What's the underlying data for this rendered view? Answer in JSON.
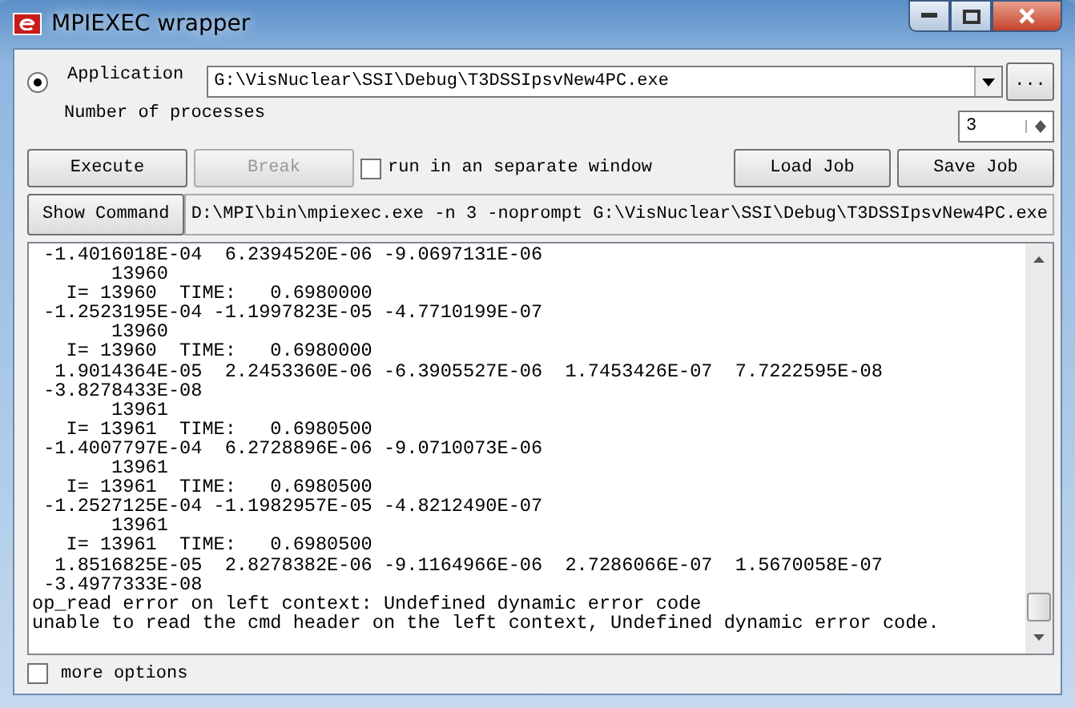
{
  "window": {
    "title": "MPIEXEC wrapper"
  },
  "application": {
    "selected": true,
    "label": "Application",
    "value": "G:\\VisNuclear\\SSI\\Debug\\T3DSSIpsvNew4PC.exe",
    "browse": "..."
  },
  "processes": {
    "label": "Number of processes",
    "value": "3"
  },
  "buttons": [
    {
      "label": "Execute",
      "disabled": false
    },
    {
      "label": "Break",
      "disabled": true
    }
  ],
  "separate_window": {
    "label": "run in an separate window",
    "checked": false
  },
  "job_buttons": [
    {
      "label": "Load Job"
    },
    {
      "label": "Save Job"
    }
  ],
  "show_command": {
    "label": "Show Command",
    "value": "D:\\MPI\\bin\\mpiexec.exe -n 3  -noprompt G:\\VisNuclear\\SSI\\Debug\\T3DSSIpsvNew4PC.exe"
  },
  "output": [
    " -1.4016018E-04  6.2394520E-06 -9.0697131E-06",
    "       13960",
    "   I= 13960  TIME:   0.6980000",
    " -1.2523195E-04 -1.1997823E-05 -4.7710199E-07",
    "       13960",
    "   I= 13960  TIME:   0.6980000",
    "  1.9014364E-05  2.2453360E-06 -6.3905527E-06  1.7453426E-07  7.7222595E-08",
    " -3.8278433E-08",
    "       13961",
    "   I= 13961  TIME:   0.6980500",
    " -1.4007797E-04  6.2728896E-06 -9.0710073E-06",
    "       13961",
    "   I= 13961  TIME:   0.6980500",
    " -1.2527125E-04 -1.1982957E-05 -4.8212490E-07",
    "       13961",
    "   I= 13961  TIME:   0.6980500",
    "  1.8516825E-05  2.8278382E-06 -9.1164966E-06  2.7286066E-07  1.5670058E-07",
    " -3.4977333E-08",
    "op_read error on left context: Undefined dynamic error code",
    "unable to read the cmd header on the left context, Undefined dynamic error code."
  ],
  "more_options": {
    "label": "more options",
    "checked": false
  }
}
